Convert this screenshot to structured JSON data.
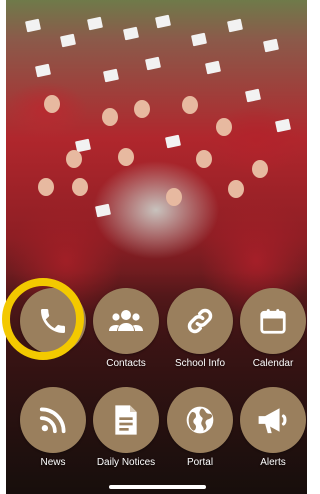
{
  "tiles": [
    {
      "label": "",
      "icon": "phone-icon"
    },
    {
      "label": "Contacts",
      "icon": "contacts-icon"
    },
    {
      "label": "School Info",
      "icon": "link-icon"
    },
    {
      "label": "Calendar",
      "icon": "calendar-icon"
    },
    {
      "label": "News",
      "icon": "rss-icon"
    },
    {
      "label": "Daily Notices",
      "icon": "document-icon"
    },
    {
      "label": "Portal",
      "icon": "globe-icon"
    },
    {
      "label": "Alerts",
      "icon": "megaphone-icon"
    }
  ],
  "colors": {
    "tile": "#9a7f5d",
    "highlight": "#f3c900"
  }
}
